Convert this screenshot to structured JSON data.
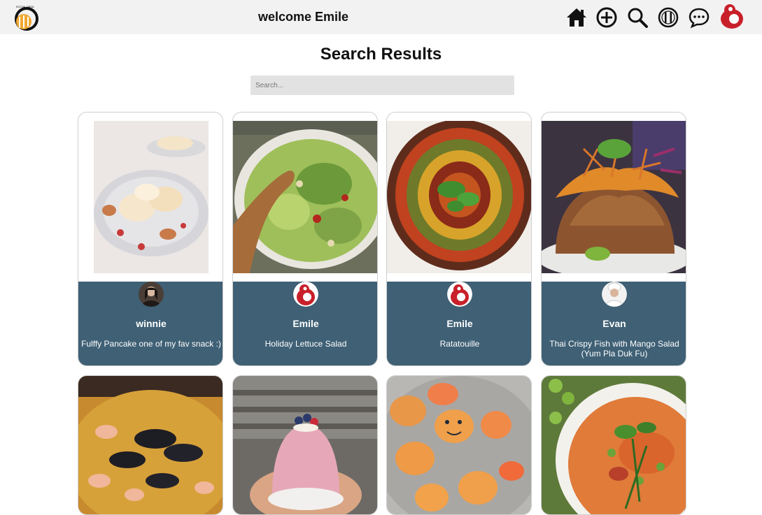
{
  "header": {
    "logo_text": "SOCIAL MEAL",
    "welcome": "welcome Emile",
    "nav": [
      {
        "icon": "home-icon"
      },
      {
        "icon": "add-circle-icon"
      },
      {
        "icon": "search-icon"
      },
      {
        "icon": "plate-cutlery-icon"
      },
      {
        "icon": "chat-bubble-icon"
      }
    ]
  },
  "page": {
    "title": "Search Results",
    "search_placeholder": "Search..."
  },
  "results": [
    {
      "author": "winnie",
      "dish": "Fulffy Pancake one of my fav snack :)"
    },
    {
      "author": "Emile",
      "dish": "Holiday Lettuce Salad"
    },
    {
      "author": "Emile",
      "dish": "Ratatouille"
    },
    {
      "author": "Evan",
      "dish": "Thai Crispy Fish with Mango Salad (Yum Pla Duk Fu)"
    }
  ],
  "colors": {
    "topbar": "#f3f2f3",
    "card_footer": "#3f6075",
    "search_bg": "#e3e2e3"
  }
}
